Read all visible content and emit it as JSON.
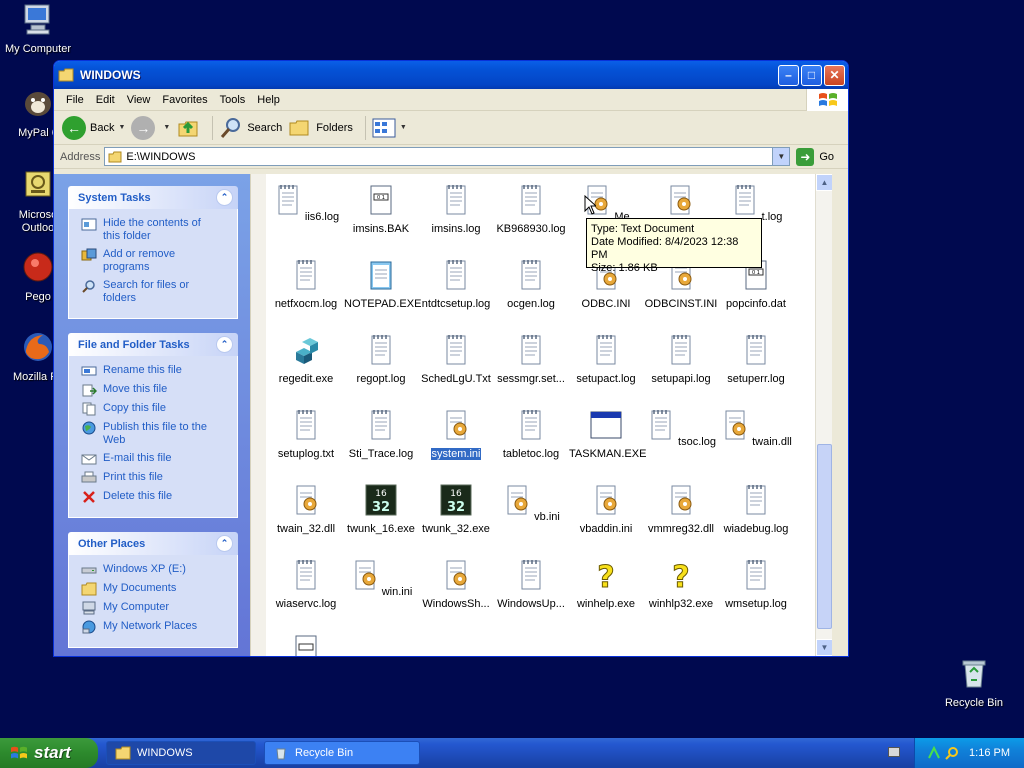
{
  "desktop": {
    "icons": [
      {
        "label": "My Computer"
      },
      {
        "label": "MyPal 6"
      },
      {
        "label": "Microsoft Outlook",
        "line1": "Microso",
        "line2": "Outloo"
      },
      {
        "label": "Pego"
      },
      {
        "label": "Mozilla Fir"
      },
      {
        "label": "Recycle Bin"
      }
    ]
  },
  "window": {
    "title": "WINDOWS",
    "menu": [
      "File",
      "Edit",
      "View",
      "Favorites",
      "Tools",
      "Help"
    ],
    "toolbar": {
      "back": "Back",
      "search": "Search",
      "folders": "Folders"
    },
    "address": {
      "label": "Address",
      "value": "E:\\WINDOWS",
      "go": "Go"
    }
  },
  "taskpane": {
    "system_tasks": {
      "title": "System Tasks",
      "items": [
        "Hide the contents of this folder",
        "Add or remove programs",
        "Search for files or folders"
      ],
      "items_lines": [
        [
          "Hide the contents of",
          "this folder"
        ],
        [
          "Add or remove",
          "programs"
        ],
        [
          "Search for files or",
          "folders"
        ]
      ]
    },
    "file_tasks": {
      "title": "File and Folder Tasks",
      "items": [
        "Rename this file",
        "Move this file",
        "Copy this file",
        "Publish this file to the Web",
        "E-mail this file",
        "Print this file",
        "Delete this file"
      ]
    },
    "other_places": {
      "title": "Other Places",
      "items": [
        "Windows XP (E:)",
        "My Documents",
        "My Computer",
        "My Network Places"
      ]
    }
  },
  "files": [
    [
      "iis6.log",
      "imsins.BAK",
      "imsins.log",
      "KB968930.log",
      "Me",
      "",
      "t.log"
    ],
    [
      "netfxocm.log",
      "NOTEPAD.EXE",
      "ntdtcsetup.log",
      "ocgen.log",
      "ODBC.INI",
      "ODBCINST.INI",
      "popcinfo.dat"
    ],
    [
      "regedit.exe",
      "regopt.log",
      "SchedLgU.Txt",
      "sessmgr.set...",
      "setupact.log",
      "setupapi.log",
      "setuperr.log"
    ],
    [
      "setuplog.txt",
      "Sti_Trace.log",
      "system.ini",
      "tabletoc.log",
      "TASKMAN.EXE",
      "tsoc.log",
      "twain.dll"
    ],
    [
      "twain_32.dll",
      "twunk_16.exe",
      "twunk_32.exe",
      "vb.ini",
      "vbaddin.ini",
      "vmmreg32.dll",
      "wiadebug.log"
    ],
    [
      "wiaservc.log",
      "win.ini",
      "WindowsSh...",
      "WindowsUp...",
      "winhelp.exe",
      "winhlp32.exe",
      "wmsetup.log"
    ]
  ],
  "selected_file": "system.ini",
  "tooltip": {
    "type": "Type: Text Document",
    "modified": "Date Modified: 8/4/2023 12:38 PM",
    "size": "Size: 1.86 KB"
  },
  "taskbar": {
    "start": "start",
    "items": [
      "WINDOWS",
      "Recycle Bin"
    ],
    "clock": "1:16 PM"
  },
  "colors": {
    "desktop": "#00094f",
    "title": "#0452d6",
    "start": "#2d8a2d",
    "task_link": "#215dc6"
  }
}
